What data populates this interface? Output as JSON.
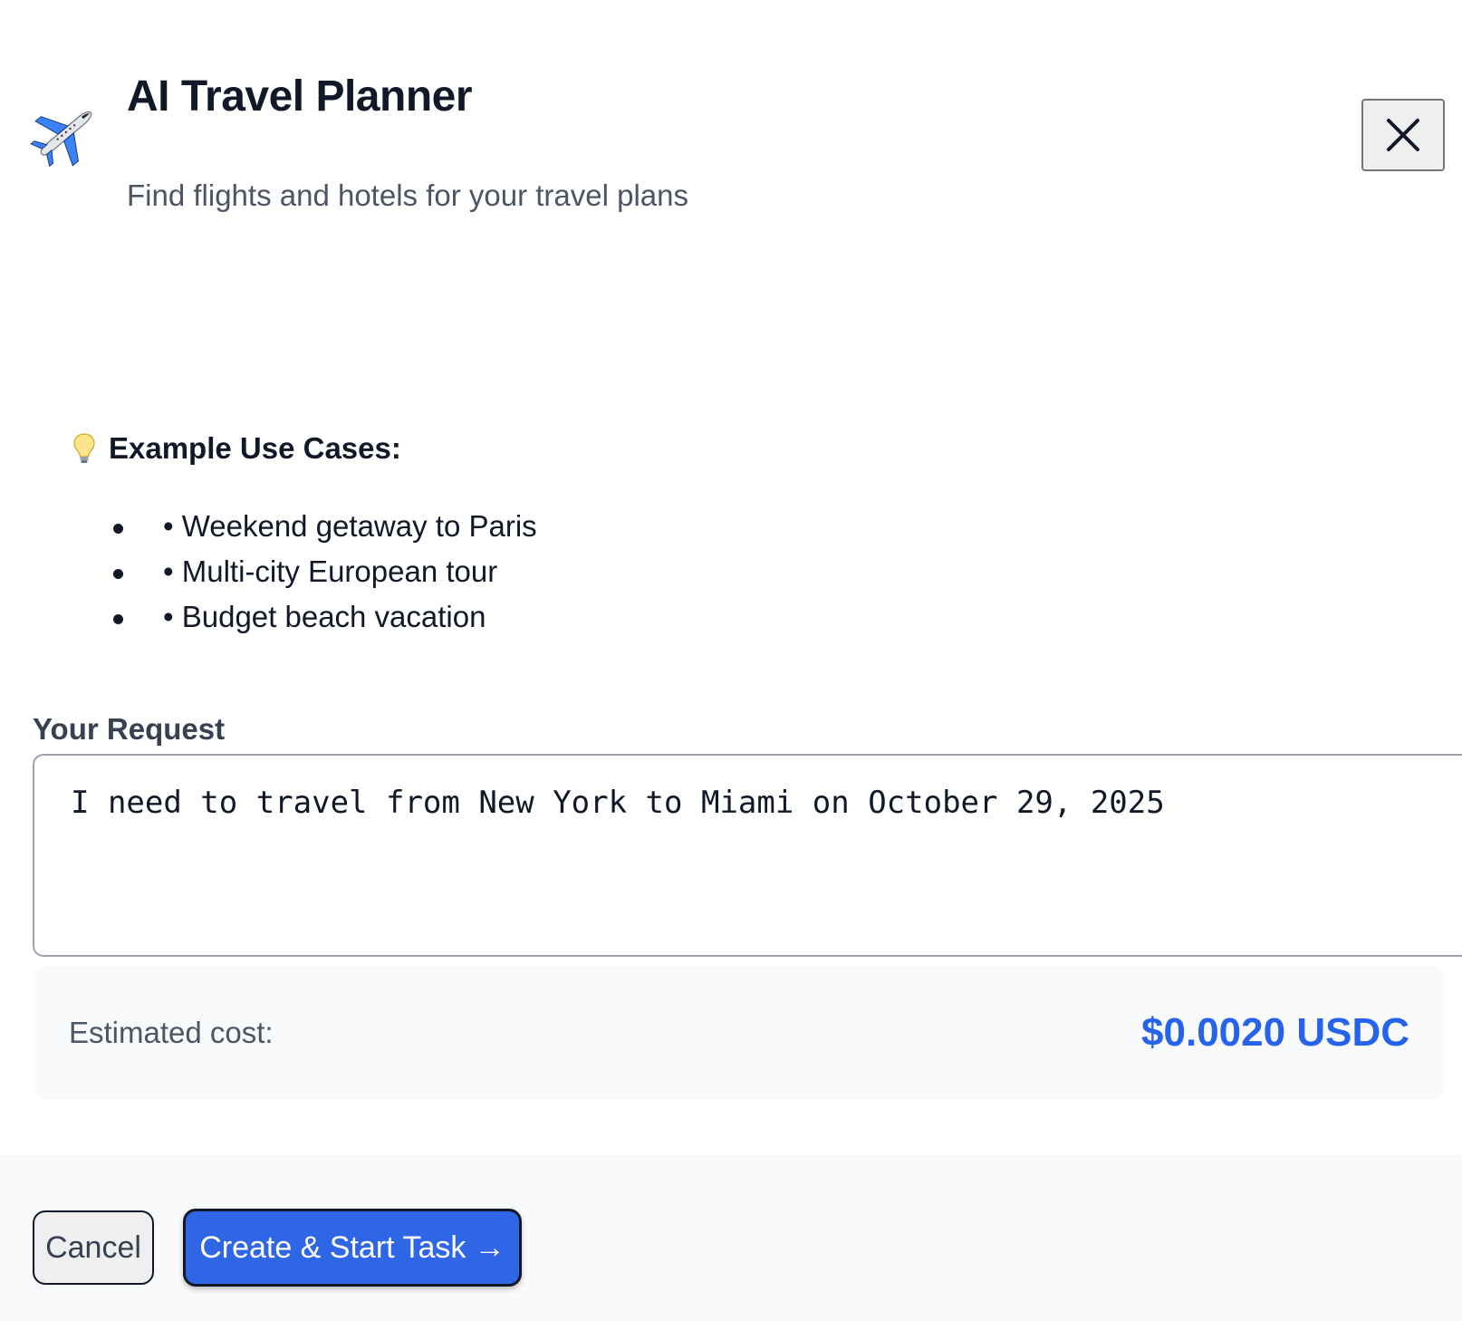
{
  "header": {
    "icon": "airplane-icon",
    "title": "AI Travel Planner",
    "subtitle": "Find flights and hotels for your travel plans",
    "close_icon": "close-icon"
  },
  "examples": {
    "icon": "lightbulb-icon",
    "title": "Example Use Cases:",
    "items": [
      "• Weekend getaway to Paris",
      "• Multi-city European tour",
      "• Budget beach vacation"
    ]
  },
  "request": {
    "label": "Your Request",
    "value": "I need to travel from New York to Miami on October 29, 2025"
  },
  "cost": {
    "label": "Estimated cost:",
    "value": "$0.0020 USDC"
  },
  "footer": {
    "cancel_label": "Cancel",
    "submit_label": "Create & Start Task →"
  },
  "colors": {
    "accent": "#2563eb",
    "button_primary": "#2f66e5",
    "title": "#111827",
    "muted": "#4b5563"
  }
}
